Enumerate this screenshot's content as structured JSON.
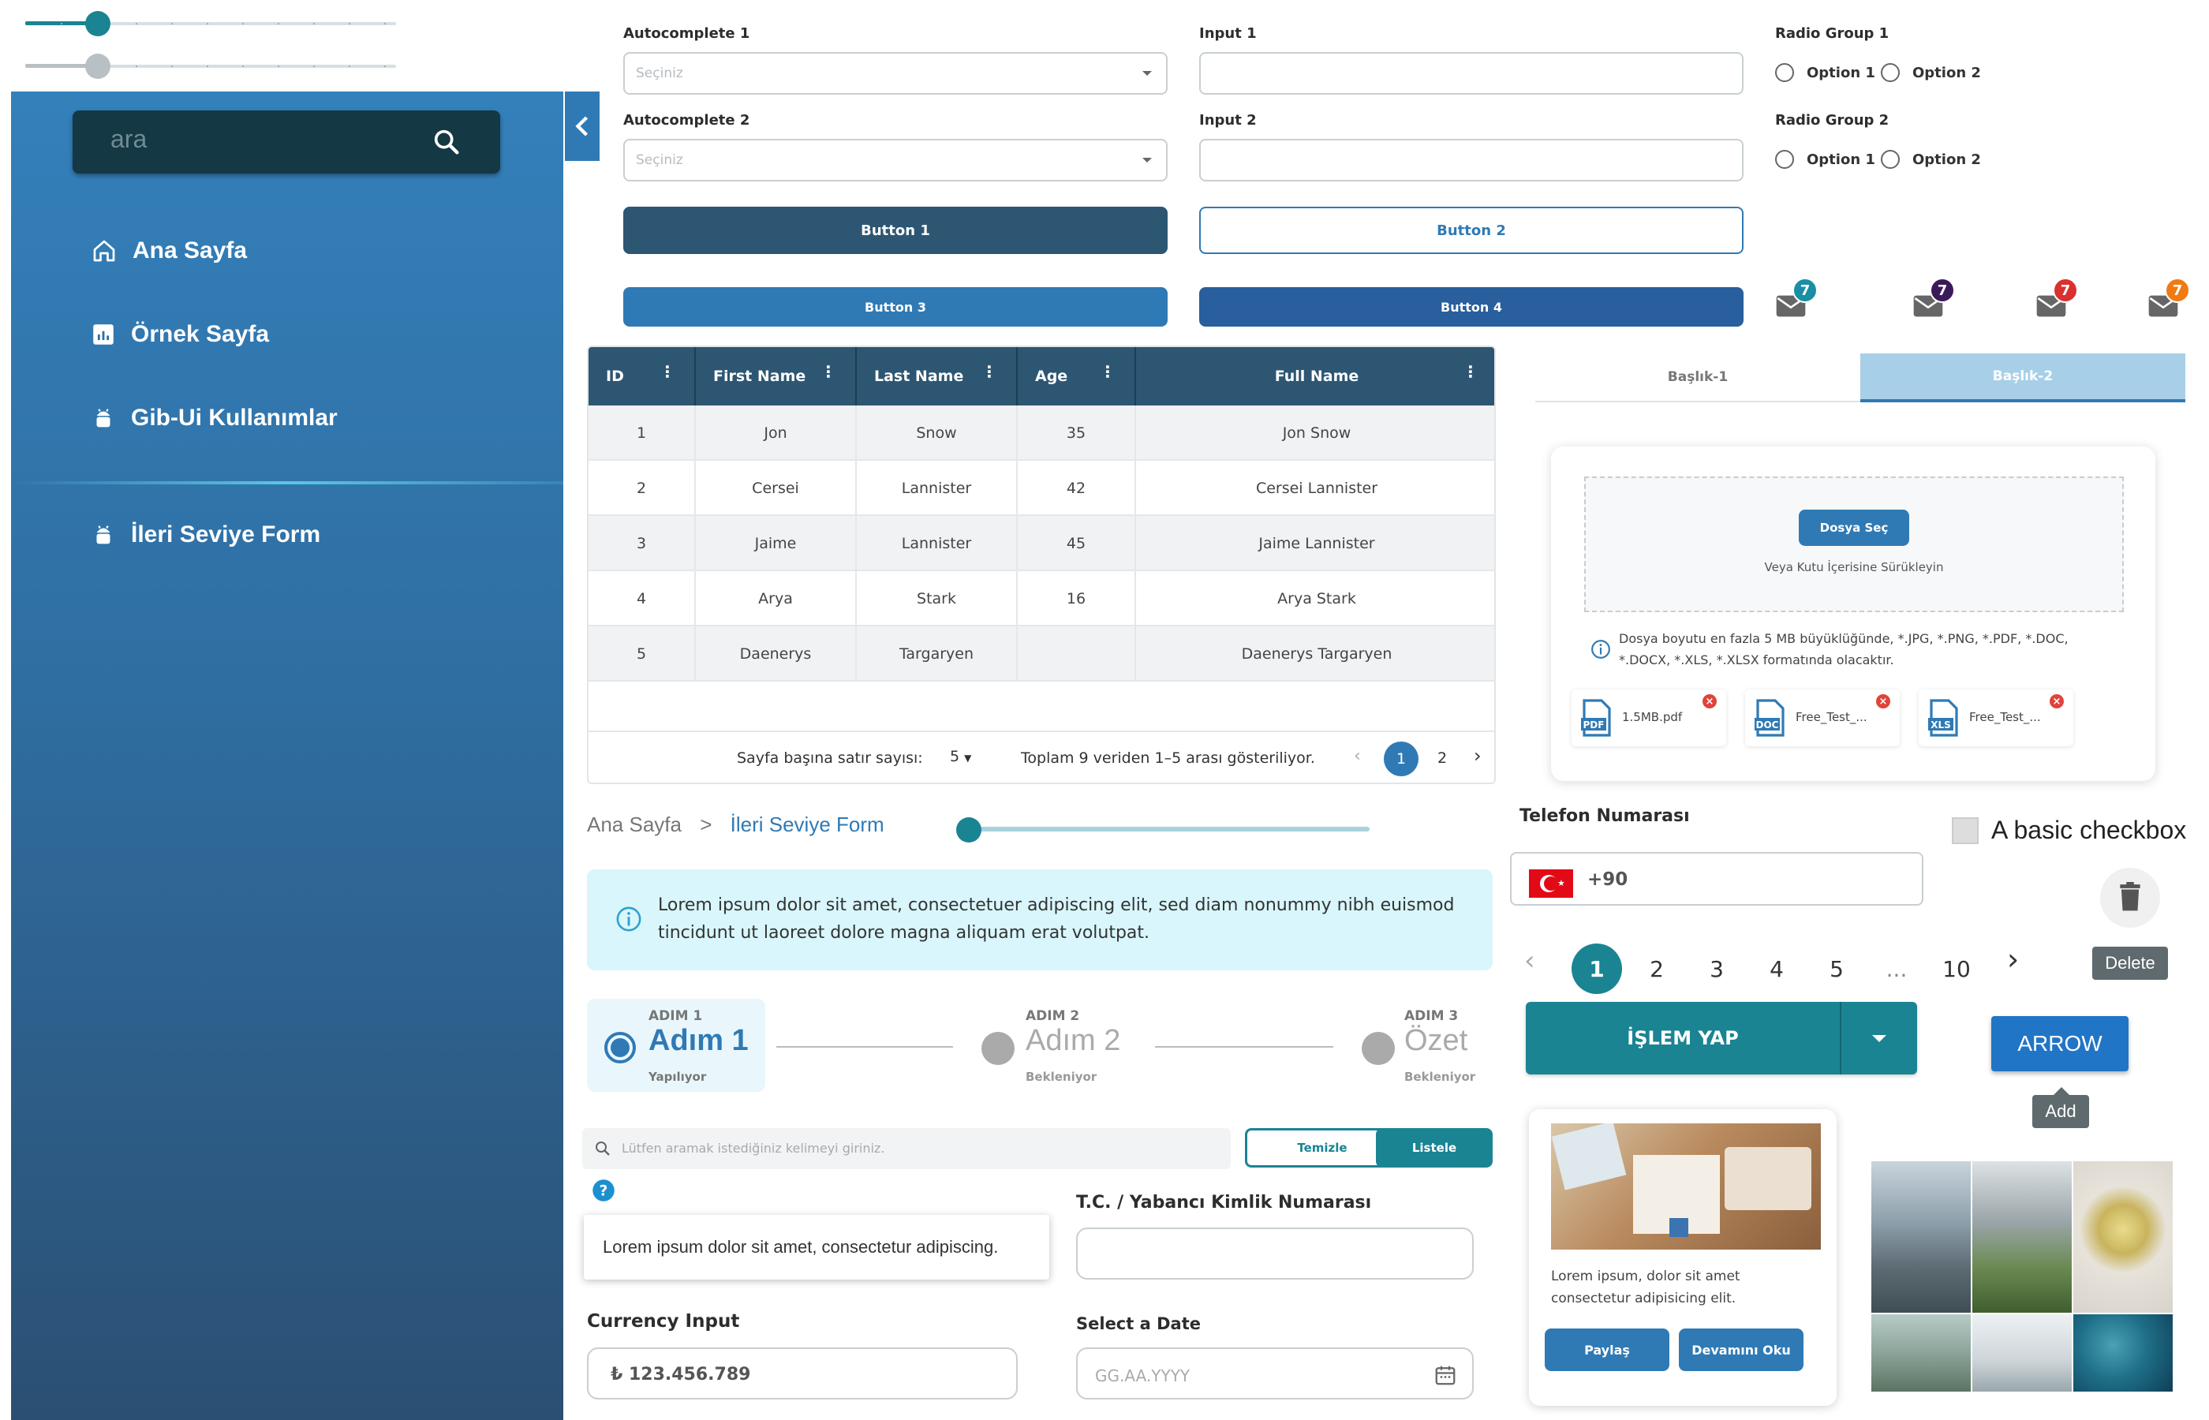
{
  "sidebar": {
    "search_placeholder": "ara",
    "items": [
      {
        "label": "Ana Sayfa"
      },
      {
        "label": "Örnek Sayfa"
      },
      {
        "label": "Gib-Ui Kullanımlar"
      },
      {
        "label": "İleri Seviye Form"
      }
    ]
  },
  "form": {
    "autocomplete1": {
      "label": "Autocomplete 1",
      "placeholder": "Seçiniz"
    },
    "autocomplete2": {
      "label": "Autocomplete 2",
      "placeholder": "Seçiniz"
    },
    "input1": {
      "label": "Input 1",
      "value": ""
    },
    "input2": {
      "label": "Input 2",
      "value": ""
    },
    "radio1": {
      "label": "Radio Group 1",
      "options": [
        "Option 1",
        "Option 2"
      ]
    },
    "radio2": {
      "label": "Radio Group 2",
      "options": [
        "Option 1",
        "Option 2"
      ]
    },
    "buttons": [
      "Button 1",
      "Button 2",
      "Button 3",
      "Button 4"
    ]
  },
  "badges": [
    {
      "count": "7",
      "color": "#1a8fa3"
    },
    {
      "count": "7",
      "color": "#3b1a5a"
    },
    {
      "count": "7",
      "color": "#d93030"
    },
    {
      "count": "7",
      "color": "#f07a14"
    }
  ],
  "table": {
    "columns": [
      "ID",
      "First Name",
      "Last Name",
      "Age",
      "Full Name"
    ],
    "rows": [
      [
        "1",
        "Jon",
        "Snow",
        "35",
        "Jon Snow"
      ],
      [
        "2",
        "Cersei",
        "Lannister",
        "42",
        "Cersei Lannister"
      ],
      [
        "3",
        "Jaime",
        "Lannister",
        "45",
        "Jaime Lannister"
      ],
      [
        "4",
        "Arya",
        "Stark",
        "16",
        "Arya Stark"
      ],
      [
        "5",
        "Daenerys",
        "Targaryen",
        "",
        "Daenerys Targaryen"
      ]
    ],
    "rows_per_page_label": "Sayfa başına satır sayısı:",
    "rows_per_page_value": "5",
    "range_text": "Toplam 9 veriden 1–5 arası gösteriliyor.",
    "pages": [
      "1",
      "2"
    ]
  },
  "tabs": [
    "Başlık-1",
    "Başlık-2"
  ],
  "upload": {
    "button": "Dosya Seç",
    "drop_text": "Veya Kutu İçerisine Sürükleyin",
    "info": "Dosya boyutu en fazla 5 MB büyüklüğünde, *.JPG, *.PNG, *.PDF, *.DOC, *.DOCX, *.XLS, *.XLSX formatında olacaktır.",
    "files": [
      {
        "name": "1.5MB.pdf",
        "type": "PDF",
        "color": "#2f7ab5"
      },
      {
        "name": "Free_Test_...",
        "type": "DOC",
        "color": "#2f7ab5"
      },
      {
        "name": "Free_Test_...",
        "type": "XLS",
        "color": "#2f7ab5"
      }
    ]
  },
  "breadcrumb": {
    "home": "Ana Sayfa",
    "separator": ">",
    "current": "İleri Seviye Form"
  },
  "slider_progress": 0,
  "info_alert": "Lorem ipsum dolor sit amet, consectetuer adipiscing elit, sed diam nonummy nibh euismod tincidunt ut laoreet dolore magna aliquam erat volutpat.",
  "stepper": [
    {
      "caption": "ADIM 1",
      "title": "Adım 1",
      "status": "Yapılıyor"
    },
    {
      "caption": "ADIM 2",
      "title": "Adım 2",
      "status": "Bekleniyor"
    },
    {
      "caption": "ADIM 3",
      "title": "Özet",
      "status": "Bekleniyor"
    }
  ],
  "searchbar": {
    "placeholder": "Lütfen aramak istediğiniz kelimeyi giriniz.",
    "clear": "Temizle",
    "list": "Listele"
  },
  "tooltip": "Lorem ipsum dolor sit amet, consectetur adipiscing.",
  "tc": {
    "label": "T.C. / Yabancı Kimlik Numarası",
    "value": ""
  },
  "currency": {
    "label": "Currency Input",
    "value": "₺ 123.456.789"
  },
  "date": {
    "label": "Select a Date",
    "placeholder": "GG.AA.YYYY"
  },
  "phone": {
    "label": "Telefon Numarası",
    "prefix": "+90"
  },
  "checkbox": {
    "label": "A basic checkbox",
    "checked": false
  },
  "delete_tooltip": "Delete",
  "pagination": {
    "pages": [
      "1",
      "2",
      "3",
      "4",
      "5",
      "...",
      "10"
    ],
    "active": "1"
  },
  "split_button": {
    "label": "İŞLEM YAP"
  },
  "arrow_button": {
    "label": "ARROW",
    "tooltip": "Add"
  },
  "card": {
    "text": "Lorem ipsum, dolor sit amet consectetur adipisicing elit.",
    "share": "Paylaş",
    "more": "Devamını Oku"
  },
  "colors": {
    "primary": "#2d5673",
    "accent": "#2f7ab5",
    "teal": "#1a8493",
    "sidebar_top": "#3480bb",
    "sidebar_bottom": "#2b4f73"
  }
}
